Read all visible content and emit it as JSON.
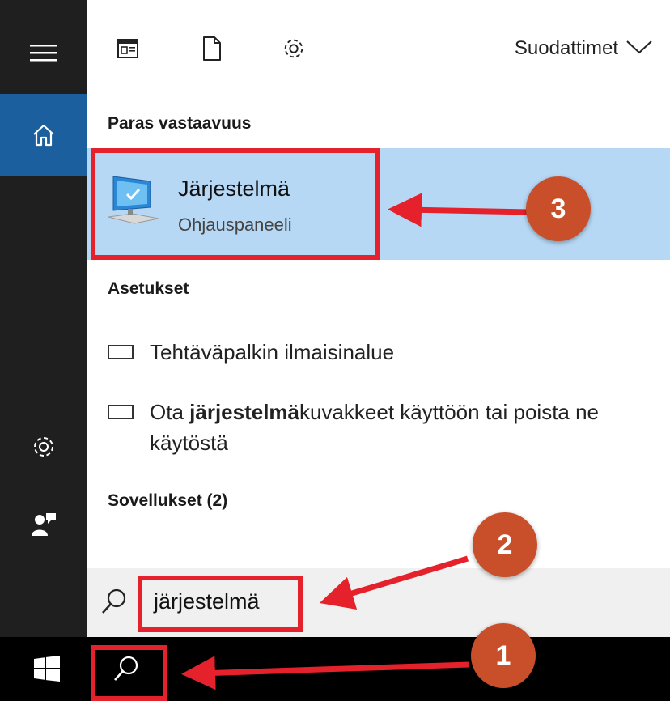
{
  "top_toolbar": {
    "filters_label": "Suodattimet"
  },
  "sections": {
    "best_match": "Paras vastaavuus",
    "settings": "Asetukset",
    "apps": "Sovellukset (2)"
  },
  "best_match_item": {
    "title": "Järjestelmä",
    "subtitle": "Ohjauspaneeli"
  },
  "settings_items": [
    {
      "text": "Tehtäväpalkin ilmaisinalue"
    },
    {
      "prefix": "Ota ",
      "bold": "järjestelmä",
      "suffix": "kuvakkeet käyttöön tai poista ne käytöstä"
    }
  ],
  "search": {
    "value": "järjestelmä"
  },
  "annotations": {
    "badge_1": "1",
    "badge_2": "2",
    "badge_3": "3"
  },
  "colors": {
    "accent_blue": "#1b5f9e",
    "highlight": "#b7d8f4",
    "annotation_red": "#e5212b",
    "badge_orange": "#c84f29"
  },
  "icons": [
    "hamburger-menu-icon",
    "home-icon",
    "settings-gear-icon",
    "feedback-person-icon",
    "news-card-icon",
    "document-icon",
    "gear-icon",
    "chevron-down-icon",
    "computer-monitor-icon",
    "keyboard-icon",
    "search-icon",
    "windows-logo-icon"
  ]
}
